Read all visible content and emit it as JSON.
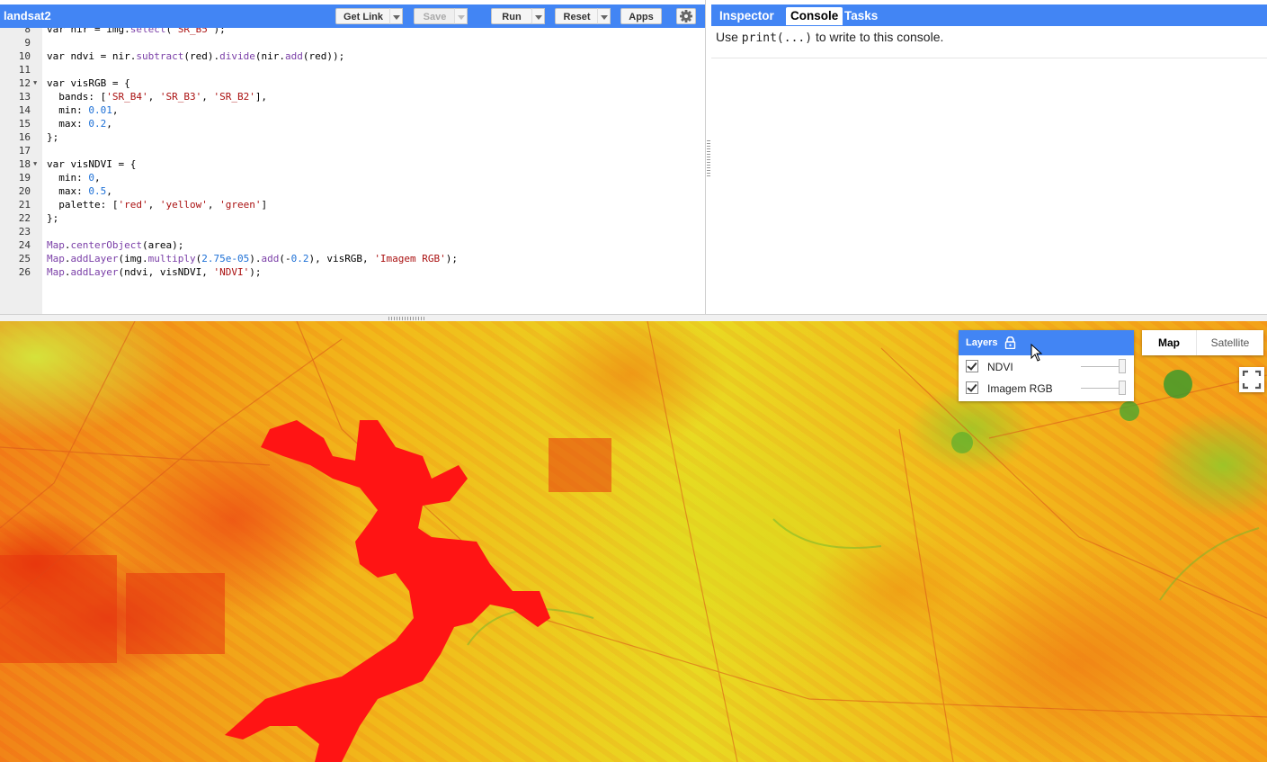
{
  "editor": {
    "script_name": "landsat2",
    "toolbar": {
      "get_link": "Get Link",
      "save": "Save",
      "run": "Run",
      "reset": "Reset",
      "apps": "Apps"
    },
    "lines": [
      {
        "n": "8",
        "fold": false,
        "text": "var nir = img.select('SR_B5');"
      },
      {
        "n": "9",
        "fold": false,
        "text": ""
      },
      {
        "n": "10",
        "fold": false,
        "text": "var ndvi = nir.subtract(red).divide(nir.add(red));"
      },
      {
        "n": "11",
        "fold": false,
        "text": ""
      },
      {
        "n": "12",
        "fold": true,
        "text": "var visRGB = {"
      },
      {
        "n": "13",
        "fold": false,
        "text": "  bands: ['SR_B4', 'SR_B3', 'SR_B2'],"
      },
      {
        "n": "14",
        "fold": false,
        "text": "  min: 0.01,"
      },
      {
        "n": "15",
        "fold": false,
        "text": "  max: 0.2,"
      },
      {
        "n": "16",
        "fold": false,
        "text": "};"
      },
      {
        "n": "17",
        "fold": false,
        "text": ""
      },
      {
        "n": "18",
        "fold": true,
        "text": "var visNDVI = {"
      },
      {
        "n": "19",
        "fold": false,
        "text": "  min: 0,"
      },
      {
        "n": "20",
        "fold": false,
        "text": "  max: 0.5,"
      },
      {
        "n": "21",
        "fold": false,
        "text": "  palette: ['red', 'yellow', 'green']"
      },
      {
        "n": "22",
        "fold": false,
        "text": "};"
      },
      {
        "n": "23",
        "fold": false,
        "text": ""
      },
      {
        "n": "24",
        "fold": false,
        "text": "Map.centerObject(area);"
      },
      {
        "n": "25",
        "fold": false,
        "text": "Map.addLayer(img.multiply(2.75e-05).add(-0.2), visRGB, 'Imagem RGB');"
      },
      {
        "n": "26",
        "fold": false,
        "text": "Map.addLayer(ndvi, visNDVI, 'NDVI');"
      }
    ]
  },
  "right_panel": {
    "tabs": [
      "Inspector",
      "Console",
      "Tasks"
    ],
    "active_tab": "Console",
    "console": {
      "prefix": "Use ",
      "code": "print(...)",
      "suffix": " to write to this console."
    }
  },
  "map": {
    "layers_title": "Layers",
    "layers": [
      {
        "name": "NDVI",
        "checked": true,
        "opacity": 1.0
      },
      {
        "name": "Imagem RGB",
        "checked": true,
        "opacity": 1.0
      }
    ],
    "map_types": [
      "Map",
      "Satellite"
    ],
    "active_map_type": "Map",
    "palette": [
      "red",
      "yellow",
      "green"
    ]
  }
}
